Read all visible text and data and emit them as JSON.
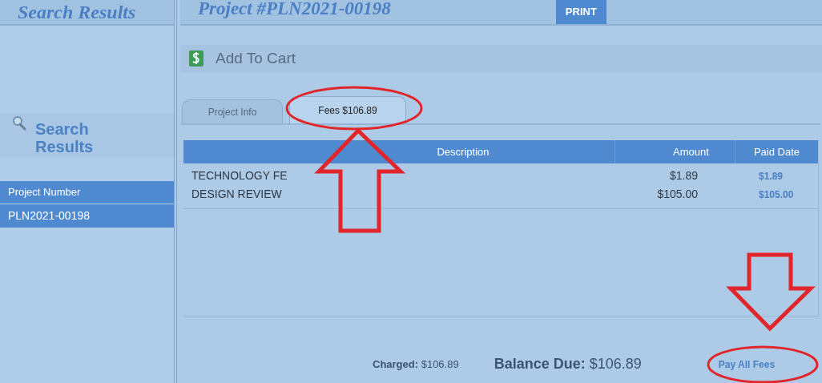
{
  "header": {
    "sidebar_title": "Search Results",
    "project_title": "Project #PLN2021-00198",
    "print_button": "PRINT"
  },
  "sidebar": {
    "heading": "Search Results",
    "column": "Project Number",
    "rows": [
      {
        "label": "PLN2021-00198",
        "selected": true
      }
    ]
  },
  "cart": {
    "label": "Add To Cart"
  },
  "tabs": [
    {
      "label": "Project Info",
      "selected": false
    },
    {
      "label": "Fees $106.89",
      "selected": true
    }
  ],
  "table": {
    "columns": [
      "Description",
      "Amount",
      "Paid Date"
    ],
    "rows": [
      {
        "description": "TECHNOLOGY FE",
        "amount": "$1.89",
        "paid_date": "$1.89"
      },
      {
        "description": "DESIGN REVIEW",
        "amount": "$105.00",
        "paid_date": "$105.00"
      }
    ]
  },
  "footer": {
    "charged": "**Charged:** $106.89",
    "balance_due": "**Balance Due:** $106.89",
    "pay_button": "Pay All Fees"
  }
}
